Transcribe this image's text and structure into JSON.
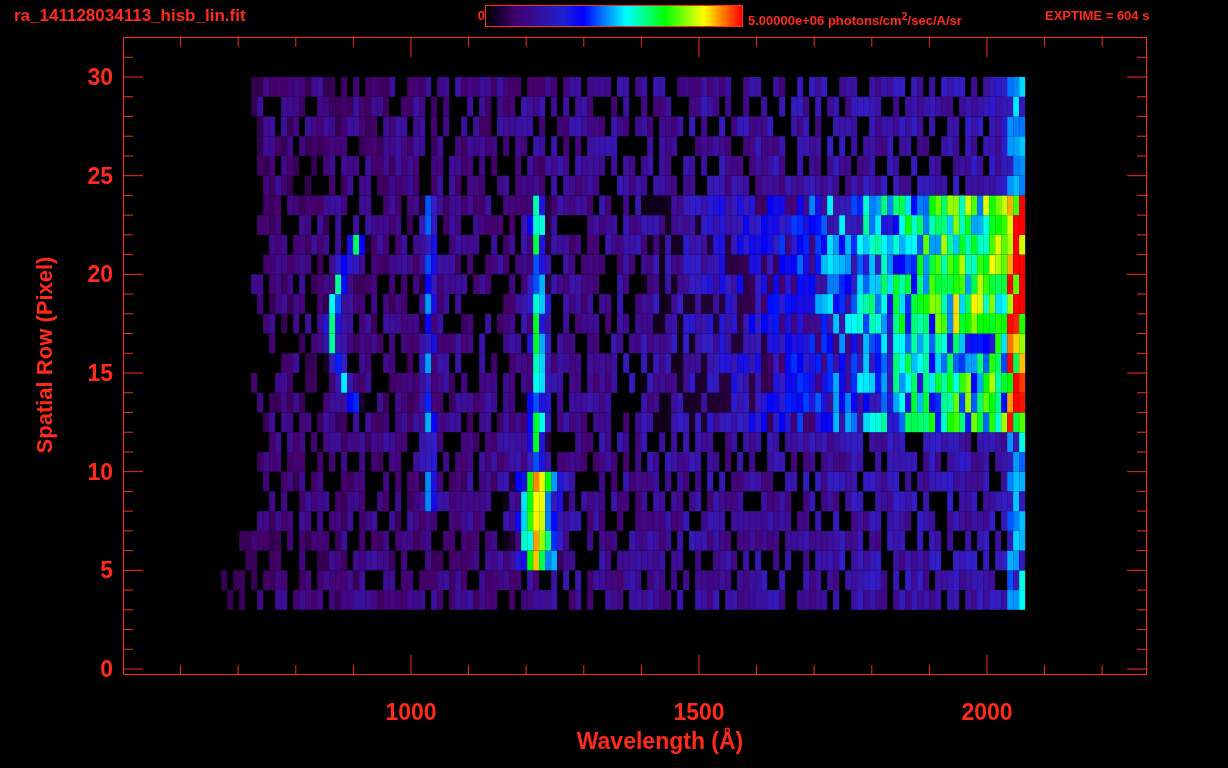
{
  "header": {
    "title": "ra_141128034113_hisb_lin.fit",
    "colorbar": {
      "min_label": "0",
      "max_label": "5.00000e+06 photons/cm$^{2}$/sec/A/sr"
    },
    "exptime": "EXPTIME = 604 s"
  },
  "plot": {
    "y_axis": {
      "title": "Spatial Row (Pixel)",
      "tick_labels": [
        "30",
        "25",
        "20",
        "15",
        "10",
        "5",
        "0"
      ]
    },
    "x_axis": {
      "title": "Wavelength (Å)",
      "tick_labels": [
        "1000",
        "1500",
        "2000"
      ]
    }
  }
}
